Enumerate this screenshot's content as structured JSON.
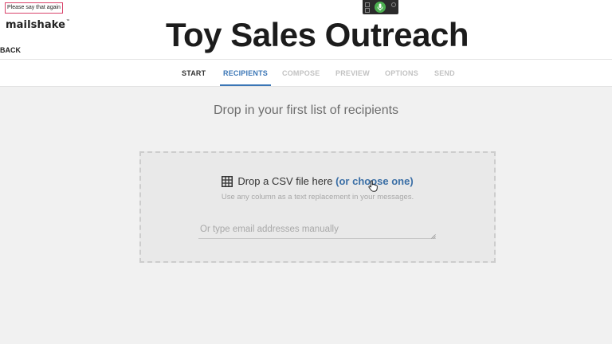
{
  "overlay": {
    "speech_tip": "Please say that again"
  },
  "header": {
    "logo": "mailshake",
    "logo_mark": "™",
    "back_label": "BACK",
    "campaign_title": "Toy Sales Outreach"
  },
  "steps": [
    {
      "label": "START",
      "state": "done"
    },
    {
      "label": "RECIPIENTS",
      "state": "active"
    },
    {
      "label": "COMPOSE",
      "state": "upcoming"
    },
    {
      "label": "PREVIEW",
      "state": "upcoming"
    },
    {
      "label": "OPTIONS",
      "state": "upcoming"
    },
    {
      "label": "SEND",
      "state": "upcoming"
    }
  ],
  "main": {
    "headline": "Drop in your first list of recipients",
    "dropzone": {
      "icon": "table-grid-icon",
      "drop_text": "Drop a CSV file here ",
      "choose_link": "(or choose one)",
      "hint": "Use any column as a text replacement in your messages.",
      "manual_input_value": "",
      "manual_input_placeholder": "Or type email addresses manually"
    }
  },
  "colors": {
    "accent": "#3b76b6",
    "mic_active": "#4caf50",
    "speech_tip_border": "#d9436b"
  }
}
